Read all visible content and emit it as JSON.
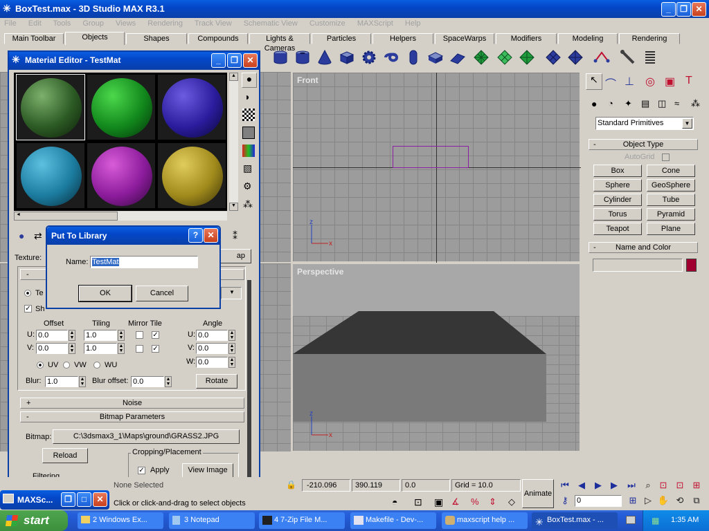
{
  "app": {
    "title": "BoxTest.max - 3D Studio MAX R3.1",
    "menu": [
      "File",
      "Edit",
      "Tools",
      "Group",
      "Views",
      "Rendering",
      "Track View",
      "Schematic View",
      "Customize",
      "MAXScript",
      "Help"
    ]
  },
  "tabs": [
    "Main Toolbar",
    "Objects",
    "Shapes",
    "Compounds",
    "Lights & Cameras",
    "Particles",
    "Helpers",
    "SpaceWarps",
    "Modifiers",
    "Modeling",
    "Rendering"
  ],
  "viewports": {
    "front": "Front",
    "perspective": "Perspective"
  },
  "material_editor": {
    "title": "Material Editor - TestMat",
    "texture_label": "Texture:",
    "map_btn": "ap",
    "coords": {
      "offset_label": "Offset",
      "tiling_label": "Tiling",
      "mirror_tile_label": "Mirror Tile",
      "angle_label": "Angle",
      "u_label": "U:",
      "v_label": "V:",
      "w_label": "W:",
      "u_offset": "0.0",
      "v_offset": "0.0",
      "u_tiling": "1.0",
      "v_tiling": "1.0",
      "u_angle": "0.0",
      "v_angle": "0.0",
      "w_angle": "0.0",
      "uv": "UV",
      "vw": "VW",
      "wu": "WU",
      "blur_label": "Blur:",
      "blur": "1.0",
      "blur_offset_label": "Blur offset:",
      "blur_offset": "0.0",
      "rotate": "Rotate",
      "te": "Te",
      "sh": "Sh"
    },
    "noise_rollout": "Noise",
    "bitmap_rollout": "Bitmap Parameters",
    "bitmap_label": "Bitmap:",
    "bitmap_path": "C:\\3dsmax3_1\\Maps\\ground\\GRASS2.JPG",
    "reload": "Reload",
    "cropping_label": "Cropping/Placement",
    "apply": "Apply",
    "view_image": "View Image",
    "filtering": "Filtering",
    "plus": "+",
    "minus": "-"
  },
  "dialog": {
    "title": "Put To Library",
    "name_label": "Name:",
    "name_value": "TestMat",
    "ok": "OK",
    "cancel": "Cancel",
    "help": "?"
  },
  "command_panel": {
    "dropdown": "Standard Primitives",
    "object_type": "Object Type",
    "autogrid": "AutoGrid",
    "buttons": [
      "Box",
      "Cone",
      "Sphere",
      "GeoSphere",
      "Cylinder",
      "Tube",
      "Torus",
      "Pyramid",
      "Teapot",
      "Plane"
    ],
    "name_and_color": "Name and Color",
    "color": "#a00030"
  },
  "status": {
    "selection": "None Selected",
    "prompt": "Click or click-and-drag to select objects",
    "x": "-210.096",
    "y": "390.119",
    "z": "0.0",
    "grid": "Grid = 10.0",
    "animate": "Animate",
    "frame": "0"
  },
  "maxscript_mini": "MAXSc...",
  "taskbar": {
    "start": "start",
    "items": [
      "2 Windows Ex...",
      "3 Notepad",
      "4 7-Zip File M...",
      "Makefile - Dev-...",
      "maxscript help ...",
      "BoxTest.max - ..."
    ],
    "time": "1:35 AM"
  }
}
